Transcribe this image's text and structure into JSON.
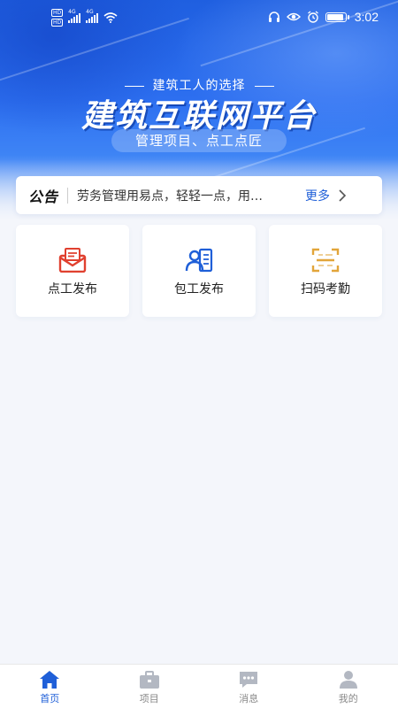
{
  "status_bar": {
    "left_badges": [
      "HD",
      "HD"
    ],
    "signal_captions": [
      "4G",
      "4G"
    ],
    "time": "3:02"
  },
  "hero": {
    "tagline": "建筑工人的选择",
    "title": "建筑互联网平台",
    "subtitle": "管理项目、点工点匠"
  },
  "notice": {
    "label": "公告",
    "text": "劳务管理用易点，轻轻一点，用…",
    "more_label": "更多"
  },
  "features": [
    {
      "label": "点工发布",
      "icon": "mail-icon",
      "color": "#e0402f"
    },
    {
      "label": "包工发布",
      "icon": "contact-card-icon",
      "color": "#1f5fd8"
    },
    {
      "label": "扫码考勤",
      "icon": "scan-icon",
      "color": "#e2a53a"
    }
  ],
  "tabbar": {
    "tabs": [
      {
        "label": "首页",
        "icon": "home-icon",
        "active": true
      },
      {
        "label": "项目",
        "icon": "briefcase-icon",
        "active": false
      },
      {
        "label": "消息",
        "icon": "chat-icon",
        "active": false
      },
      {
        "label": "我的",
        "icon": "user-icon",
        "active": false
      }
    ]
  },
  "colors": {
    "accent": "#1f5fd8",
    "hero_blue": "#2d6ff0",
    "background": "#f4f6fb",
    "inactive_tab": "#b3b8c2"
  }
}
